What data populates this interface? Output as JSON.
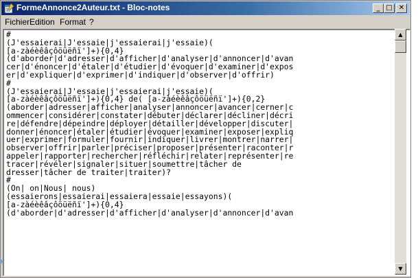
{
  "window": {
    "title": "FormeAnnonce2Auteur.txt - Bloc-notes",
    "controls": {
      "minimize": "_",
      "maximize": "□",
      "close": "✕"
    }
  },
  "menubar": {
    "items": [
      "Fichier",
      "Edition",
      "Format",
      "?"
    ]
  },
  "editor": {
    "lines": [
      "#",
      "(J'essaierai|J'essaie|j'essaierai|j'essaie)(",
      "[a-zàéèêâçôöüëñï']+){0,4}",
      "(d'aborder|d'adresser|d'afficher|d'analyser|d'annoncer|d'avan",
      "cer|d'énoncer|d'étaler|d'étudier|d'évoquer|d'examiner|d'expos",
      "er|d'expliquer|d'exprimer|d'indiquer|d'observer|d'offrir)",
      "#",
      "(J'essaierai|J'essaie|j'essaierai|j'essaie)(",
      "[a-zàéèêâçôöüëñï']+){0,4} de( [a-zàéèêâçôöüëñï']+){0,2}",
      "(aborder|adresser|afficher|analyser|annoncer|avancer|cerner|c",
      "ommencer|considérer|constater|débuter|déclarer|décliner|décri",
      "re|défendre|dépeindre|déployer|détailler|développer|discuter|",
      "donner|énoncer|étaler|étudier|évoquer|examiner|exposer|expliq",
      "uer|exprimer|formuler|fournir|indiquer|livrer|montrer|narrer|",
      "observer|offrir|parler|préciser|proposer|présenter|raconter|r",
      "appeler|rapporter|rechercher|réfléchir|relater|représenter|re",
      "tracer|révéler|signaler|situer|soumettre|tâcher de",
      "dresser|tâcher de traiter|traiter)?",
      "#",
      "(On| on|Nous| nous)",
      "(essaierons|essaierai|essaiera|essaie|essayons)(",
      "[a-zàéèêâçôöüëñï']+){0,4}",
      "(d'aborder|d'adresser|d'afficher|d'analyser|d'annoncer|d'avan"
    ]
  },
  "scrollbar": {
    "up": "▲",
    "down": "▼"
  },
  "colors": {
    "titlebar_start": "#0a246a",
    "titlebar_end": "#a6caf0",
    "chrome": "#d4d0c8"
  }
}
